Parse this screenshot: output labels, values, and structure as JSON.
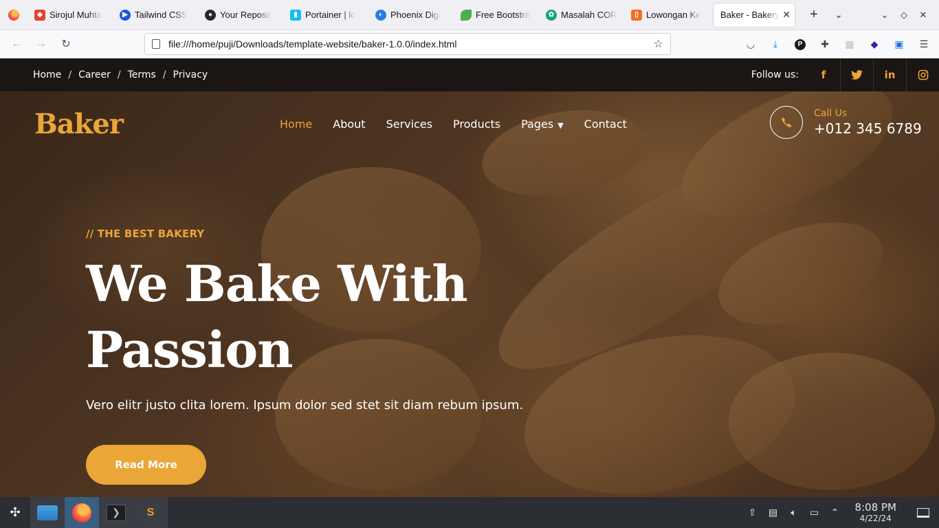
{
  "browser": {
    "tabs": [
      {
        "title": "Sirojul Muhta",
        "icon": "gitlab-icon",
        "color": "#e2432a"
      },
      {
        "title": "Tailwind CSS",
        "icon": "tailwind-icon",
        "color": "#1a56db"
      },
      {
        "title": "Your Reposit",
        "icon": "github-icon",
        "color": "#24292f"
      },
      {
        "title": "Portainer | lo",
        "icon": "portainer-icon",
        "color": "#13bef9"
      },
      {
        "title": "Phoenix Digi",
        "icon": "phoenix-icon",
        "color": "#2a7de1"
      },
      {
        "title": "Free Bootstra",
        "icon": "leaf-icon",
        "color": "#4caf50"
      },
      {
        "title": "Masalah COR",
        "icon": "openai-icon",
        "color": "#10a37f"
      },
      {
        "title": "Lowongan Ke",
        "icon": "job-icon",
        "color": "#f36f21"
      },
      {
        "title": "Baker - Bakery",
        "icon": "page-icon",
        "color": "#ffffff",
        "active": true
      }
    ],
    "new_tab_label": "+",
    "url": "file:///home/puji/Downloads/template-website/baker-1.0.0/index.html"
  },
  "site": {
    "topbar": {
      "links": [
        "Home",
        "Career",
        "Terms",
        "Privacy"
      ],
      "separator": "/",
      "follow_label": "Follow us:",
      "social": [
        "f",
        "t",
        "in",
        "ig"
      ]
    },
    "brand": "Baker",
    "menu": {
      "home": "Home",
      "about": "About",
      "services": "Services",
      "products": "Products",
      "pages": "Pages",
      "contact": "Contact"
    },
    "call": {
      "label": "Call Us",
      "number": "+012 345 6789"
    },
    "hero": {
      "eyebrow": "// THE BEST BAKERY",
      "headline": "We Bake With Passion",
      "subtitle": "Vero elitr justo clita lorem. Ipsum dolor sed stet sit diam rebum ipsum.",
      "cta": "Read More"
    },
    "colors": {
      "accent": "#eaa636",
      "dark": "#1b1613"
    }
  },
  "taskbar": {
    "apps": [
      "files",
      "firefox",
      "terminal",
      "sublime-text"
    ],
    "time": "8:08 PM",
    "date": "4/22/24"
  }
}
